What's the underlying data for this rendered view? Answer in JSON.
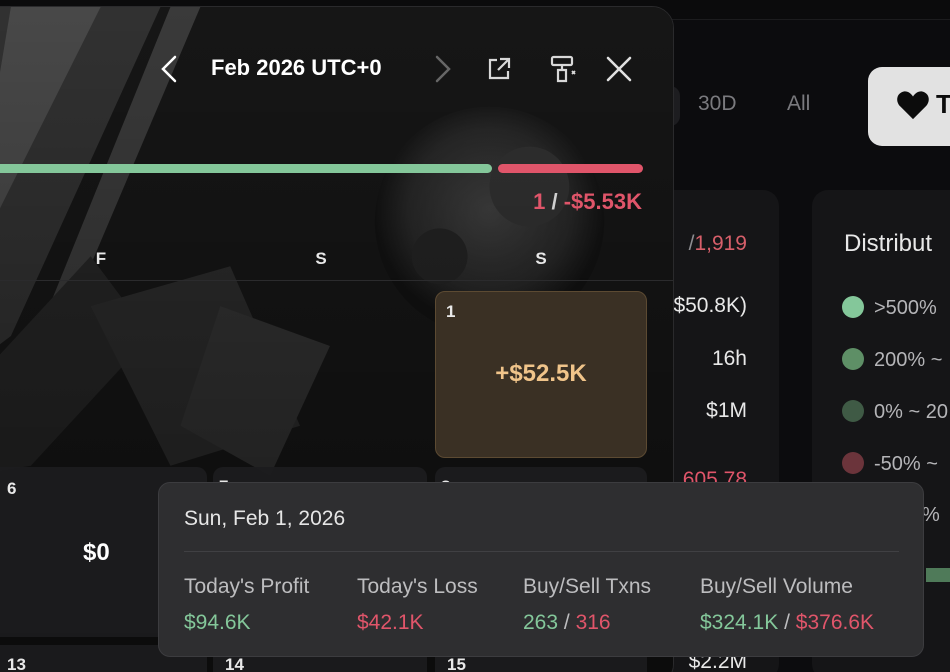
{
  "background": {
    "range_pills": [
      "30D",
      "All"
    ],
    "track_button_label": "T",
    "stats": {
      "row1_sep": "/",
      "row1_red": "1,919",
      "row2": "$50.8K)",
      "row3": "16h",
      "row4": "$1M",
      "row5": "605.78",
      "row6": "$2.2M"
    },
    "distribution": {
      "title": "Distribut",
      "items": [
        {
          "label": ">500%",
          "color": "#84c79a"
        },
        {
          "label": "200% ~",
          "color": "#5e8f66"
        },
        {
          "label": "0% ~ 20",
          "color": "#3f5a45"
        },
        {
          "label": "-50% ~",
          "color": "#6b343b"
        },
        {
          "label": "%",
          "color": "#d75f6a"
        }
      ]
    }
  },
  "modal": {
    "month_label": "Feb 2026 UTC+0",
    "summary": {
      "count": "1",
      "separator": "/",
      "amount": "-$5.53K"
    },
    "weekdays": [
      "F",
      "S",
      "S"
    ],
    "days": [
      {
        "num": "1",
        "value": "+$52.5K"
      },
      {
        "num": "6",
        "value": "$0"
      },
      {
        "num": "7",
        "value": ""
      },
      {
        "num": "8",
        "value": ""
      },
      {
        "num": "13",
        "value": ""
      },
      {
        "num": "14",
        "value": ""
      },
      {
        "num": "15",
        "value": ""
      }
    ]
  },
  "tooltip": {
    "date": "Sun, Feb 1, 2026",
    "profit_label": "Today's Profit",
    "profit_value": "$94.6K",
    "loss_label": "Today's Loss",
    "loss_value": "$42.1K",
    "txns_label": "Buy/Sell Txns",
    "txns_buy": "263",
    "txns_sell": "316",
    "volume_label": "Buy/Sell Volume",
    "volume_buy": "$324.1K",
    "volume_sell": "$376.6K",
    "slash": "/"
  }
}
